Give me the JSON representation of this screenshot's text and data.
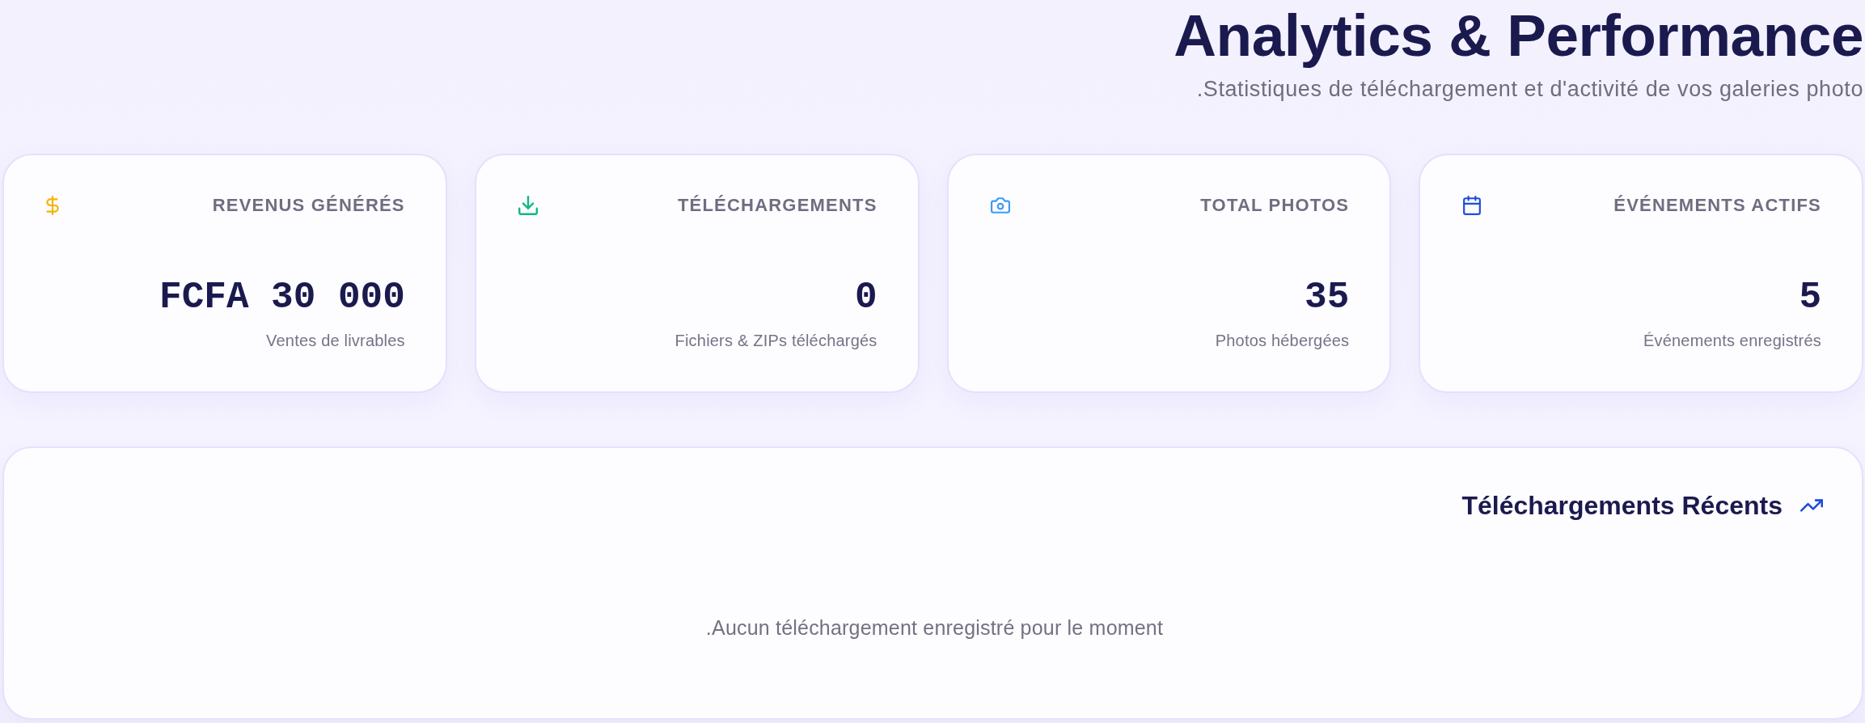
{
  "header": {
    "title": "Analytics & Performance",
    "subtitle": ".Statistiques de téléchargement et d'activité de vos galeries photo"
  },
  "stats": [
    {
      "kind": "revenue",
      "color": "#f5b400",
      "label": "REVENUS GÉNÉRÉS",
      "value": "FCFA 30 000",
      "caption": "Ventes de livrables"
    },
    {
      "kind": "downloads",
      "color": "#10b981",
      "label": "TÉLÉCHARGEMENTS",
      "value": "0",
      "caption": "Fichiers & ZIPs téléchargés"
    },
    {
      "kind": "photos",
      "color": "#3b9cf6",
      "label": "TOTAL PHOTOS",
      "value": "35",
      "caption": "Photos hébergées"
    },
    {
      "kind": "events",
      "color": "#1d4ed8",
      "label": "ÉVÉNEMENTS ACTIFS",
      "value": "5",
      "caption": "Événements enregistrés"
    }
  ],
  "recent_downloads": {
    "title": "Téléchargements Récents",
    "empty_message": ".Aucun téléchargement enregistré pour le moment"
  }
}
